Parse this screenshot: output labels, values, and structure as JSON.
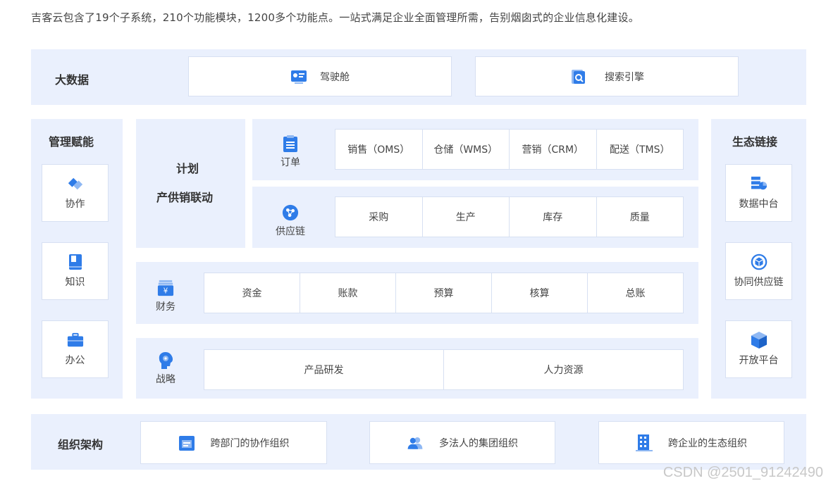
{
  "intro": "吉客云包含了19个子系统，210个功能模块，1200多个功能点。一站式满足企业全面管理所需，告别烟囱式的企业信息化建设。",
  "big_data": {
    "title": "大数据",
    "items": [
      {
        "label": "驾驶舱",
        "icon": "dashboard-icon"
      },
      {
        "label": "搜索引擎",
        "icon": "search-engine-icon"
      }
    ]
  },
  "mgmt": {
    "title": "管理赋能",
    "items": [
      {
        "label": "协作",
        "icon": "collaboration-icon"
      },
      {
        "label": "知识",
        "icon": "book-icon"
      },
      {
        "label": "办公",
        "icon": "briefcase-icon"
      }
    ]
  },
  "plan": {
    "line1": "计划",
    "line2": "产供销联动"
  },
  "order": {
    "label": "订单",
    "icon": "clipboard-icon",
    "cells": [
      "销售（OMS）",
      "仓储（WMS）",
      "营销（CRM）",
      "配送（TMS）"
    ]
  },
  "supply": {
    "label": "供应链",
    "icon": "network-icon",
    "cells": [
      "采购",
      "生产",
      "库存",
      "质量"
    ]
  },
  "finance": {
    "label": "财务",
    "icon": "money-icon",
    "cells": [
      "资金",
      "账款",
      "预算",
      "核算",
      "总账"
    ]
  },
  "strategy": {
    "label": "战略",
    "icon": "brain-icon",
    "cells": [
      "产品研发",
      "人力资源"
    ]
  },
  "eco": {
    "title": "生态链接",
    "items": [
      {
        "label": "数据中台",
        "icon": "data-center-icon"
      },
      {
        "label": "协同供应链",
        "icon": "cube-ring-icon"
      },
      {
        "label": "开放平台",
        "icon": "cube-icon"
      }
    ]
  },
  "org": {
    "title": "组织架构",
    "items": [
      {
        "label": "跨部门的协作组织",
        "icon": "calendar-icon"
      },
      {
        "label": "多法人的集团组织",
        "icon": "users-icon"
      },
      {
        "label": "跨企业的生态组织",
        "icon": "building-icon"
      }
    ]
  },
  "watermark": "CSDN @2501_91242490",
  "colors": {
    "primary": "#2f7ce8",
    "panel": "#eaf0fd",
    "border": "#d7e0f2"
  }
}
